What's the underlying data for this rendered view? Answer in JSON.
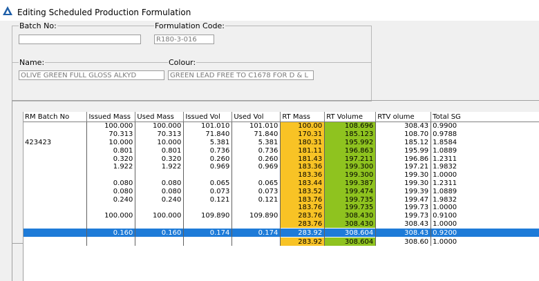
{
  "window": {
    "title": "Editing Scheduled Production Formulation"
  },
  "header": {
    "batch_label": "Batch No:",
    "batch_value": "",
    "formulation_label": "Formulation Code:",
    "formulation_value": "R180-3-016",
    "name_label": "Name:",
    "name_value": "OLIVE GREEN  FULL GLOSS ALKYD",
    "colour_label": "Colour:",
    "colour_value": "GREEN LEAD FREE TO C1678 FOR D & L"
  },
  "grid": {
    "columns": [
      "RM Batch No",
      "Issued Mass",
      "Used Mass",
      "Issued Vol",
      "Used Vol",
      "RT Mass",
      "RT Volume",
      "RTV olume",
      "Total SG"
    ],
    "rows": [
      [
        "",
        "100.000",
        "100.000",
        "101.010",
        "101.010",
        "100.00",
        "108.696",
        "308.43",
        "0.9900"
      ],
      [
        "",
        "70.313",
        "70.313",
        "71.840",
        "71.840",
        "170.31",
        "185.123",
        "108.70",
        "0.9788"
      ],
      [
        "423423",
        "10.000",
        "10.000",
        "5.381",
        "5.381",
        "180.31",
        "195.992",
        "185.12",
        "1.8584"
      ],
      [
        "",
        "0.801",
        "0.801",
        "0.736",
        "0.736",
        "181.11",
        "196.863",
        "195.99",
        "1.0889"
      ],
      [
        "",
        "0.320",
        "0.320",
        "0.260",
        "0.260",
        "181.43",
        "197.211",
        "196.86",
        "1.2311"
      ],
      [
        "",
        "1.922",
        "1.922",
        "0.969",
        "0.969",
        "183.36",
        "199.300",
        "197.21",
        "1.9832"
      ],
      [
        "",
        "",
        "",
        "",
        "",
        "183.36",
        "199.300",
        "199.30",
        "1.0000"
      ],
      [
        "",
        "0.080",
        "0.080",
        "0.065",
        "0.065",
        "183.44",
        "199.387",
        "199.30",
        "1.2311"
      ],
      [
        "",
        "0.080",
        "0.080",
        "0.073",
        "0.073",
        "183.52",
        "199.474",
        "199.39",
        "1.0889"
      ],
      [
        "",
        "0.240",
        "0.240",
        "0.121",
        "0.121",
        "183.76",
        "199.735",
        "199.47",
        "1.9832"
      ],
      [
        "",
        "",
        "",
        "",
        "",
        "183.76",
        "199.735",
        "199.73",
        "1.0000"
      ],
      [
        "",
        "100.000",
        "100.000",
        "109.890",
        "109.890",
        "283.76",
        "308.430",
        "199.73",
        "0.9100"
      ],
      [
        "",
        "",
        "",
        "",
        "",
        "283.76",
        "308.430",
        "308.43",
        "1.0000"
      ],
      [
        "",
        "0.160",
        "0.160",
        "0.174",
        "0.174",
        "283.92",
        "308.604",
        "308.43",
        "0.9200"
      ],
      [
        "",
        "",
        "",
        "",
        "",
        "283.92",
        "308.604",
        "308.60",
        "1.0000"
      ]
    ],
    "selected_row": 13
  },
  "colors": {
    "rt_mass": "#f8c325",
    "rt_volume": "#8fc31f",
    "selection": "#1e7bd8"
  }
}
